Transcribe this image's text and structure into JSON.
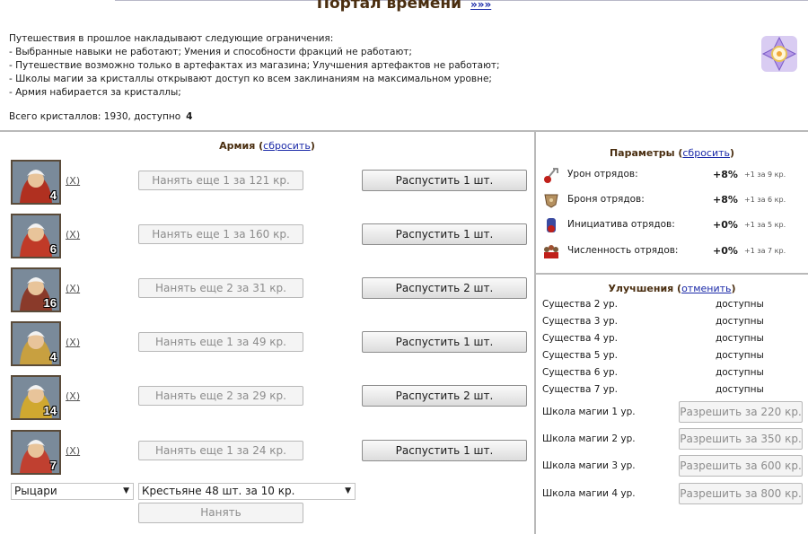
{
  "header": {
    "title": "Портал времени",
    "more_link": "»»»",
    "intro_lines": [
      "Путешествия в прошлое накладывают следующие ограничения:",
      "- Выбранные навыки не работают; Умения и способности фракций не работают;",
      "- Путешествие возможно только в артефактах из магазина; Улучшения артефактов не работают;",
      "- Школы магии за кристаллы открывают доступ ко всем заклинаниям на максимальном уровне;",
      "- Армия набирается за кристаллы;"
    ],
    "total_label": "Всего кристаллов: 1930, доступно",
    "available": "4",
    "icon": "portal-crystal-icon"
  },
  "army": {
    "title": "Армия",
    "reset_link": "сбросить",
    "rows": [
      {
        "count": "4",
        "remove": "(X)",
        "hire": "Нанять еще 1 за 121 кр.",
        "dismiss": "Распустить 1 шт.",
        "color": "#b03020"
      },
      {
        "count": "6",
        "remove": "(X)",
        "hire": "Нанять еще 1 за 160 кр.",
        "dismiss": "Распустить 1 шт.",
        "color": "#c03a28"
      },
      {
        "count": "16",
        "remove": "(X)",
        "hire": "Нанять еще 2 за 31 кр.",
        "dismiss": "Распустить 2 шт.",
        "color": "#8a3a2a"
      },
      {
        "count": "4",
        "remove": "(X)",
        "hire": "Нанять еще 1 за 49 кр.",
        "dismiss": "Распустить 1 шт.",
        "color": "#c8a040"
      },
      {
        "count": "14",
        "remove": "(X)",
        "hire": "Нанять еще 2 за 29 кр.",
        "dismiss": "Распустить 2 шт.",
        "color": "#d0a830"
      },
      {
        "count": "7",
        "remove": "(X)",
        "hire": "Нанять еще 1 за 24 кр.",
        "dismiss": "Распустить 1 шт.",
        "color": "#c04030"
      }
    ],
    "faction_select": "Рыцари",
    "unit_select": "Крестьяне 48 шт. за 10 кр.",
    "hire_button": "Нанять"
  },
  "params": {
    "title": "Параметры",
    "reset_link": "сбросить",
    "rows": [
      {
        "label": "Урон отрядов:",
        "value": "+8%",
        "note": "+1 за 9 кр.",
        "icon": "damage-icon"
      },
      {
        "label": "Броня отрядов:",
        "value": "+8%",
        "note": "+1 за 6 кр.",
        "icon": "armor-icon"
      },
      {
        "label": "Инициатива отрядов:",
        "value": "+0%",
        "note": "+1 за 5 кр.",
        "icon": "initiative-icon"
      },
      {
        "label": "Численность отрядов:",
        "value": "+0%",
        "note": "+1 за 7 кр.",
        "icon": "troops-icon"
      }
    ]
  },
  "upgrades": {
    "title": "Улучшения",
    "cancel_link": "отменить",
    "rows": [
      {
        "label": "Существа 2 ур.",
        "status": "доступны"
      },
      {
        "label": "Существа 3 ур.",
        "status": "доступны"
      },
      {
        "label": "Существа 4 ур.",
        "status": "доступны"
      },
      {
        "label": "Существа 5 ур.",
        "status": "доступны"
      },
      {
        "label": "Существа 6 ур.",
        "status": "доступны"
      },
      {
        "label": "Существа 7 ур.",
        "status": "доступны"
      }
    ],
    "magic": [
      {
        "label": "Школа магии 1 ур.",
        "button": "Разрешить за 220 кр."
      },
      {
        "label": "Школа магии 2 ур.",
        "button": "Разрешить за 350 кр."
      },
      {
        "label": "Школа магии 3 ур.",
        "button": "Разрешить за 600 кр."
      },
      {
        "label": "Школа магии 4 ур.",
        "button": "Разрешить за 800 кр."
      }
    ]
  }
}
